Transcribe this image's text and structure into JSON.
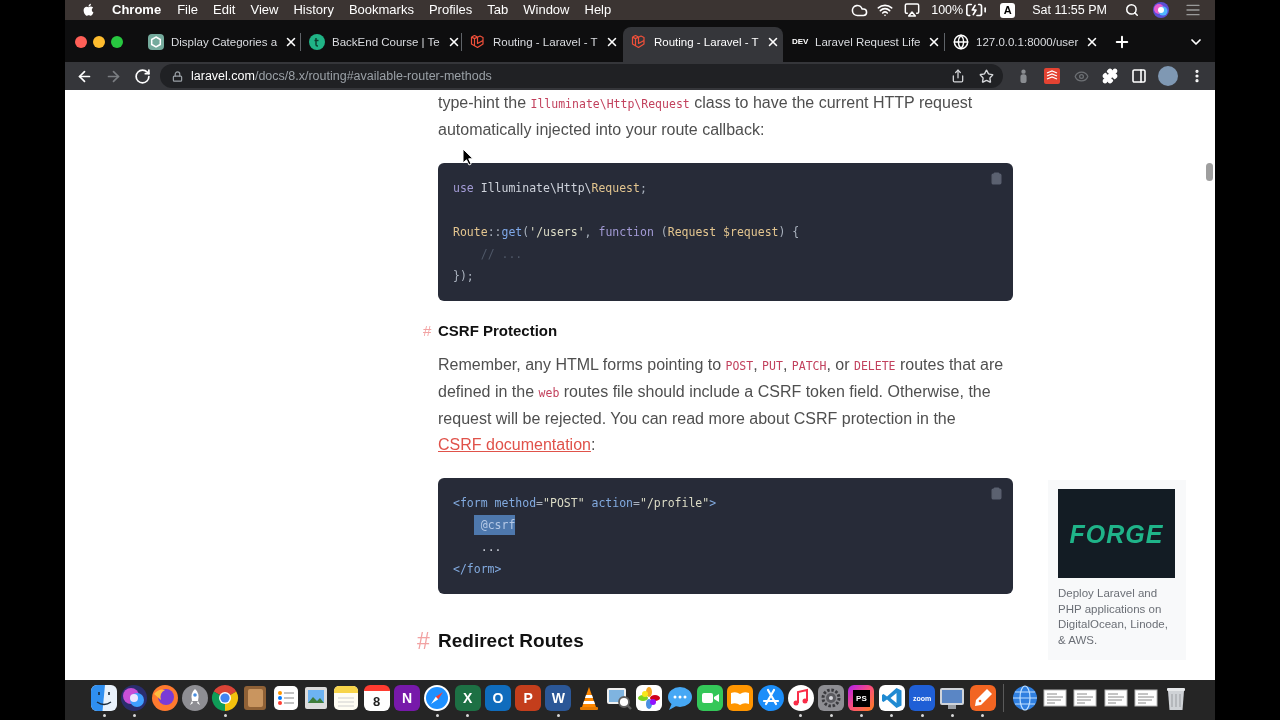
{
  "menu_bar": {
    "app_name": "Chrome",
    "menus": [
      "File",
      "Edit",
      "View",
      "History",
      "Bookmarks",
      "Profiles",
      "Tab",
      "Window",
      "Help"
    ],
    "battery": "100%",
    "input_source": "A",
    "clock": "Sat 11:55 PM"
  },
  "tabs": [
    {
      "kind": "chat",
      "title": "Display Categories a",
      "selected": false
    },
    {
      "kind": "course",
      "title": "BackEnd Course | Te",
      "selected": false
    },
    {
      "kind": "laravel",
      "title": "Routing - Laravel - T",
      "selected": false
    },
    {
      "kind": "laravel",
      "title": "Routing - Laravel - T",
      "selected": true
    },
    {
      "kind": "dev",
      "badge": "DEV",
      "title": "Laravel Request Life",
      "selected": false
    },
    {
      "kind": "web",
      "title": "127.0.0.1:8000/user",
      "selected": false
    }
  ],
  "toolbar": {
    "nav": [
      {
        "kind": "back",
        "disabled": false
      },
      {
        "kind": "forward",
        "disabled": true
      },
      {
        "kind": "reload",
        "disabled": false
      }
    ],
    "address": {
      "host": "laravel.com",
      "path": "/docs/8.x/routing#available-router-methods"
    },
    "bookmarked": false
  },
  "content": [
    {
      "kind": "paragraph",
      "segments": [
        {
          "kind": "text",
          "text": "type-hint the "
        },
        {
          "kind": "code",
          "text": "Illuminate\\Http\\Request"
        },
        {
          "kind": "text",
          "text": " class to have the current HTTP request automatically injected into your route callback:"
        }
      ]
    },
    {
      "kind": "code",
      "sections": [
        {
          "lines": [
            {
              "selected": false,
              "tokens": [
                {
                  "kind": "keyword",
                  "text": "use"
                },
                {
                  "kind": "plain",
                  "text": " Illuminate\\Http\\"
                },
                {
                  "kind": "class",
                  "text": "Request"
                },
                {
                  "kind": "punct",
                  "text": ";"
                }
              ]
            }
          ]
        },
        {
          "lines": [
            {
              "selected": false,
              "tokens": [
                {
                  "kind": "class",
                  "text": "Route"
                },
                {
                  "kind": "punct",
                  "text": "::"
                },
                {
                  "kind": "function",
                  "text": "get"
                },
                {
                  "kind": "punct",
                  "text": "("
                },
                {
                  "kind": "string",
                  "text": "'/users'"
                },
                {
                  "kind": "punct",
                  "text": ", "
                },
                {
                  "kind": "keyword",
                  "text": "function"
                },
                {
                  "kind": "punct",
                  "text": " ("
                },
                {
                  "kind": "class",
                  "text": "Request"
                },
                {
                  "kind": "variable",
                  "text": " $request"
                },
                {
                  "kind": "punct",
                  "text": ") {"
                }
              ]
            },
            {
              "selected": false,
              "tokens": [
                {
                  "kind": "comment",
                  "text": "    // ..."
                }
              ]
            },
            {
              "selected": false,
              "tokens": [
                {
                  "kind": "punct",
                  "text": "});"
                }
              ]
            }
          ]
        }
      ]
    },
    {
      "kind": "subheading",
      "anchor": "#",
      "text": "CSRF Protection"
    },
    {
      "kind": "paragraph",
      "segments": [
        {
          "kind": "text",
          "text": "Remember, any HTML forms pointing to "
        },
        {
          "kind": "code",
          "text": "POST"
        },
        {
          "kind": "text",
          "text": ", "
        },
        {
          "kind": "code",
          "text": "PUT"
        },
        {
          "kind": "text",
          "text": ", "
        },
        {
          "kind": "code",
          "text": "PATCH"
        },
        {
          "kind": "text",
          "text": ", or "
        },
        {
          "kind": "code",
          "text": "DELETE"
        },
        {
          "kind": "text",
          "text": " routes that are defined in the "
        },
        {
          "kind": "code",
          "text": "web"
        },
        {
          "kind": "text",
          "text": " routes file should include a CSRF token field. Otherwise, the request will be rejected. You can read more about CSRF protection in the "
        },
        {
          "kind": "link",
          "text": "CSRF documentation"
        },
        {
          "kind": "text",
          "text": ":"
        }
      ]
    },
    {
      "kind": "code",
      "sections": [
        {
          "lines": [
            {
              "selected": false,
              "tokens": [
                {
                  "kind": "tag",
                  "text": "<form"
                },
                {
                  "kind": "attr",
                  "text": " method"
                },
                {
                  "kind": "punct",
                  "text": "="
                },
                {
                  "kind": "string",
                  "text": "\"POST\""
                },
                {
                  "kind": "attr",
                  "text": " action"
                },
                {
                  "kind": "punct",
                  "text": "="
                },
                {
                  "kind": "string",
                  "text": "\"/profile\""
                },
                {
                  "kind": "tag",
                  "text": ">"
                }
              ]
            },
            {
              "selected": true,
              "tokens": [
                {
                  "kind": "directive",
                  "text": "    @csrf"
                }
              ]
            },
            {
              "selected": false,
              "tokens": [
                {
                  "kind": "plain",
                  "text": "    ..."
                }
              ]
            },
            {
              "selected": false,
              "tokens": [
                {
                  "kind": "tag",
                  "text": "</form>"
                }
              ]
            }
          ]
        }
      ]
    },
    {
      "kind": "heading",
      "anchor": "#",
      "text": "Redirect Routes"
    }
  ],
  "ad": {
    "logo_text": "FORGE",
    "text": "Deploy Laravel and PHP applications on DigitalOcean, Linode, & AWS."
  },
  "dock": {
    "apps": [
      {
        "kind": "finder",
        "running": true
      },
      {
        "kind": "siri",
        "running": true
      },
      {
        "kind": "firefox",
        "running": false
      },
      {
        "kind": "launchpad",
        "running": false
      },
      {
        "kind": "chrome",
        "running": true
      },
      {
        "kind": "notebook",
        "running": false
      },
      {
        "kind": "reminders",
        "running": false
      },
      {
        "kind": "preview",
        "running": false
      },
      {
        "kind": "notes",
        "running": false
      },
      {
        "kind": "calendar",
        "glyph": "8",
        "running": false
      },
      {
        "kind": "onenote",
        "glyph": "N",
        "running": false
      },
      {
        "kind": "safari",
        "running": true
      },
      {
        "kind": "excel",
        "glyph": "X",
        "running": true
      },
      {
        "kind": "outlook",
        "glyph": "O",
        "running": false
      },
      {
        "kind": "powerpoint",
        "glyph": "P",
        "running": false
      },
      {
        "kind": "word",
        "glyph": "W",
        "running": true
      },
      {
        "kind": "vlc",
        "running": false
      },
      {
        "kind": "magnifier",
        "running": false
      },
      {
        "kind": "photos",
        "running": false
      },
      {
        "kind": "messages",
        "running": false
      },
      {
        "kind": "facetime",
        "running": false
      },
      {
        "kind": "books",
        "running": false
      },
      {
        "kind": "appstore",
        "running": false
      },
      {
        "kind": "music",
        "running": true
      },
      {
        "kind": "settings",
        "running": true
      },
      {
        "kind": "phpstorm",
        "glyph": "PS",
        "running": true
      },
      {
        "kind": "vscode",
        "running": true
      },
      {
        "kind": "zoom",
        "glyph": "zoom",
        "running": true
      },
      {
        "kind": "monitor",
        "running": true
      },
      {
        "kind": "pen",
        "running": true
      }
    ],
    "files": [
      {
        "kind": "globe"
      },
      {
        "kind": "document"
      },
      {
        "kind": "document"
      },
      {
        "kind": "document"
      },
      {
        "kind": "document"
      },
      {
        "kind": "trash"
      }
    ]
  }
}
